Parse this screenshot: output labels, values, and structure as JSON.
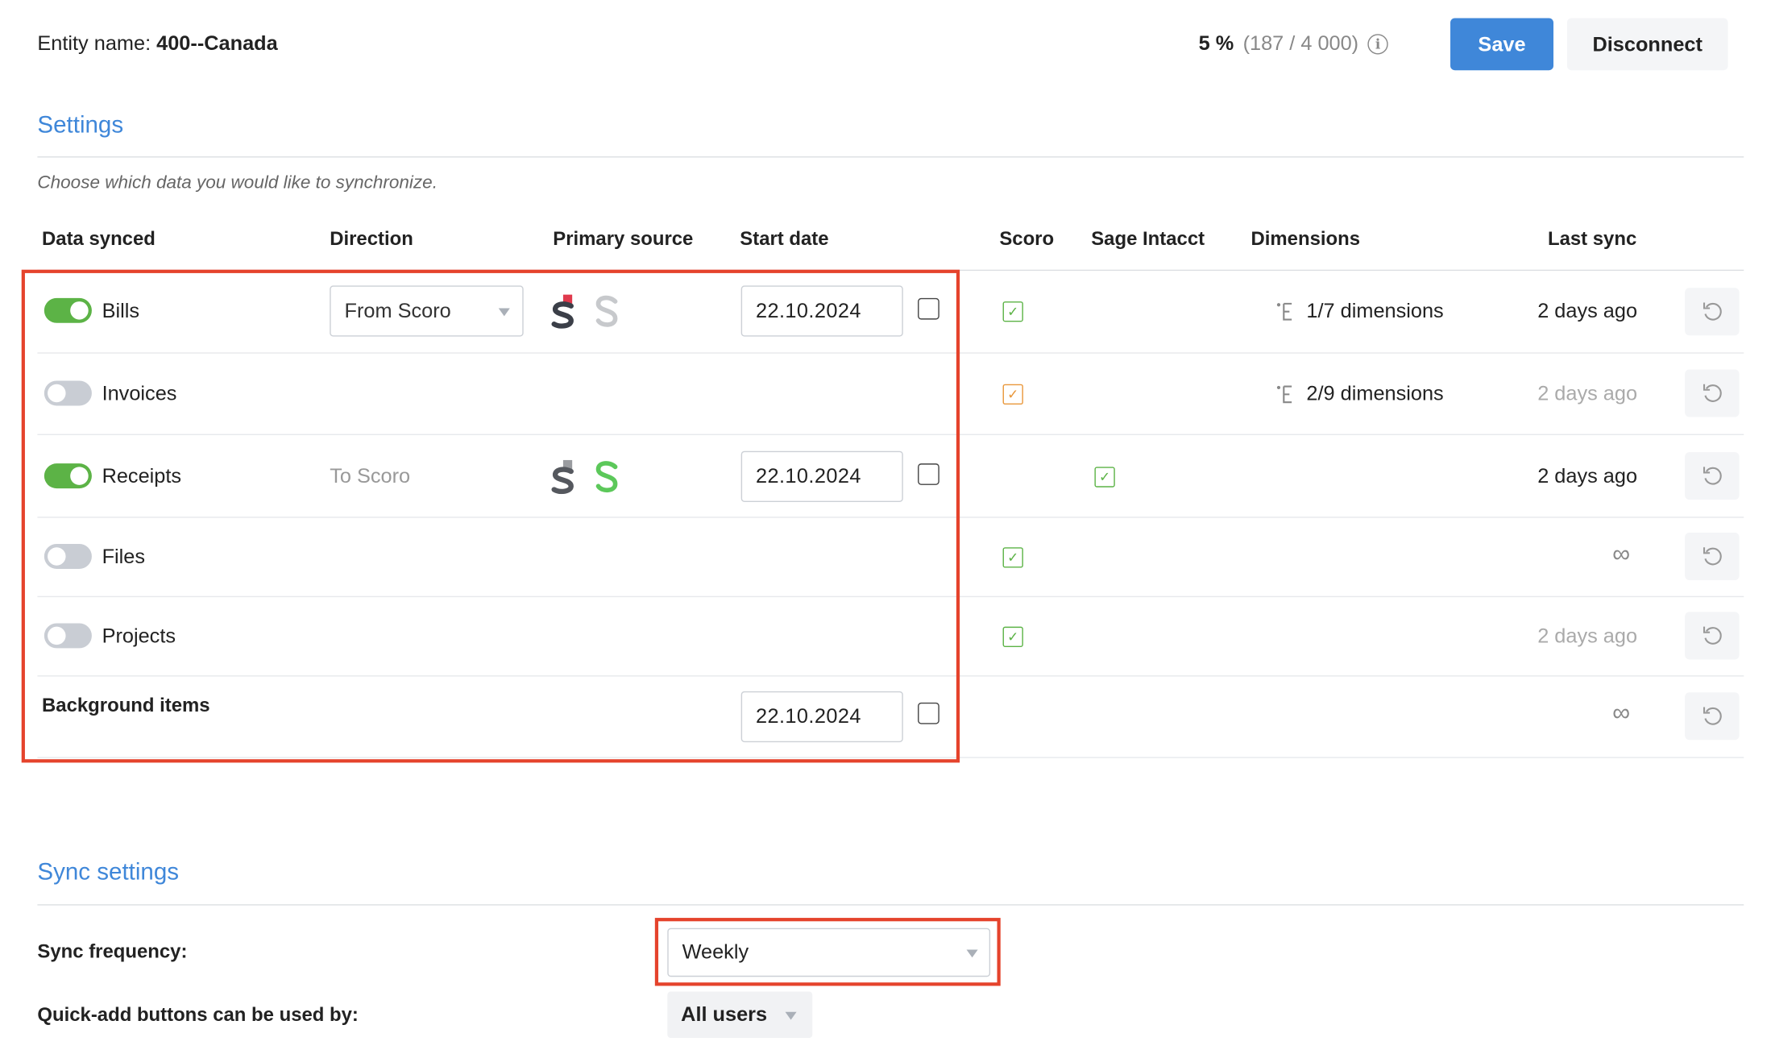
{
  "header": {
    "entity_label": "Entity name:",
    "entity_name": "400--Canada",
    "usage_percent": "5 %",
    "usage_count": "(187 / 4 000)",
    "save_label": "Save",
    "disconnect_label": "Disconnect"
  },
  "settings": {
    "title": "Settings",
    "subtitle": "Choose which data you would like to synchronize.",
    "columns": {
      "data_synced": "Data synced",
      "direction": "Direction",
      "primary_source": "Primary source",
      "start_date": "Start date",
      "scoro": "Scoro",
      "sage": "Sage Intacct",
      "dimensions": "Dimensions",
      "last_sync": "Last sync"
    },
    "rows": [
      {
        "label": "Bills",
        "enabled": true,
        "direction": "From Scoro",
        "start_date": "22.10.2024",
        "scoro_checked": true,
        "dimensions": "1/7 dimensions",
        "last_sync": "2 days ago"
      },
      {
        "label": "Invoices",
        "enabled": false,
        "scoro_checked": true,
        "dimensions": "2/9 dimensions",
        "last_sync": "2 days ago"
      },
      {
        "label": "Receipts",
        "enabled": true,
        "direction": "To Scoro",
        "start_date": "22.10.2024",
        "sage_checked": true,
        "last_sync": "2 days ago"
      },
      {
        "label": "Files",
        "enabled": false,
        "scoro_checked": true,
        "last_sync_icon": "infinity-icon"
      },
      {
        "label": "Projects",
        "enabled": false,
        "scoro_checked": true,
        "last_sync": "2 days ago"
      },
      {
        "label": "Background items",
        "start_date": "22.10.2024",
        "last_sync_icon": "infinity-icon"
      }
    ]
  },
  "sync_settings": {
    "title": "Sync settings",
    "frequency_label": "Sync frequency:",
    "frequency_value": "Weekly",
    "quickadd_label": "Quick-add buttons can be used by:",
    "quickadd_value": "All users"
  },
  "colors": {
    "accent": "#3f87d9",
    "toggle_on": "#5cb346",
    "highlight": "#e5432c",
    "scoro_red": "#e03a4d",
    "sage_green": "#5cc85a"
  }
}
